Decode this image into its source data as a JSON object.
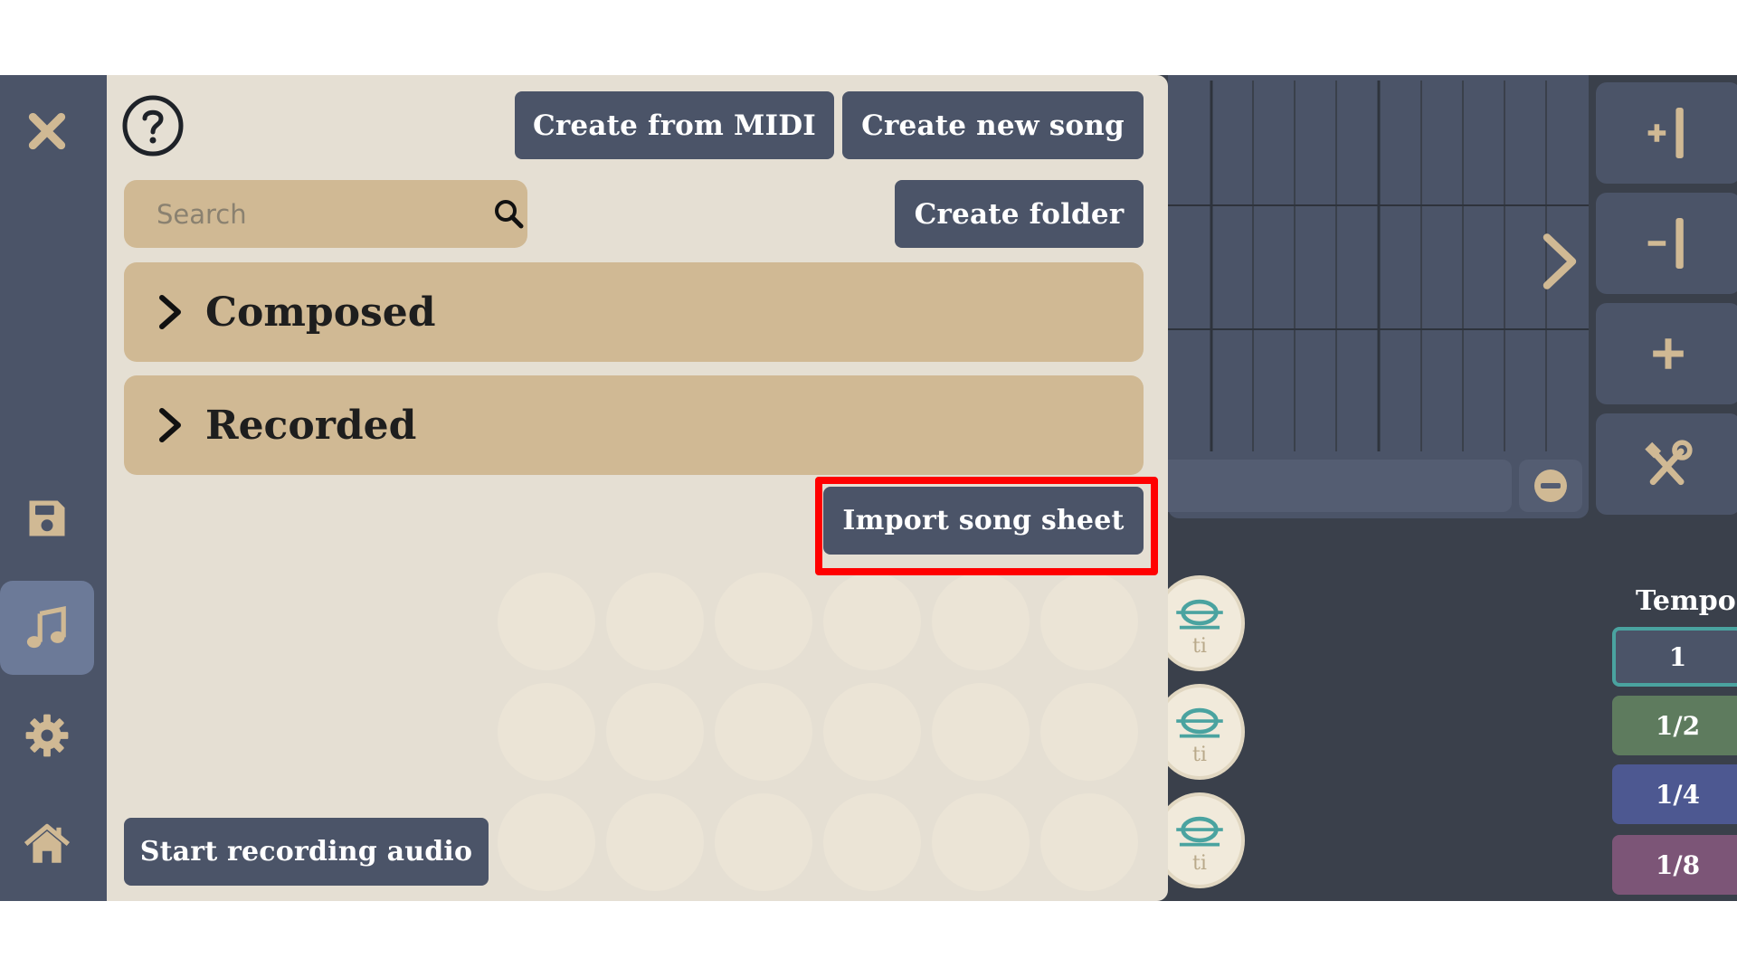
{
  "left_nav": {
    "items": [
      {
        "icon": "close-icon",
        "color": "#d0b994"
      },
      {
        "icon": "save-icon",
        "color": "#d0b994"
      },
      {
        "icon": "music-note-icon",
        "color": "#d0b994",
        "active": true
      },
      {
        "icon": "gear-icon",
        "color": "#d0b994"
      },
      {
        "icon": "home-icon",
        "color": "#d0b994"
      }
    ]
  },
  "menu": {
    "help_icon": "question-circle-icon",
    "create_from_midi_label": "Create from MIDI",
    "create_new_song_label": "Create new song",
    "search_placeholder": "Search",
    "create_folder_label": "Create folder",
    "folders": [
      {
        "label": "Composed"
      },
      {
        "label": "Recorded"
      }
    ],
    "import_song_sheet_label": "Import song sheet",
    "start_recording_label": "Start recording audio"
  },
  "toolbar": {
    "add_column_icon": "add-column-icon",
    "remove_column_icon": "remove-column-icon",
    "add_icon": "plus-icon",
    "tools_icon": "tools-icon"
  },
  "notes": [
    {
      "label": "ti"
    },
    {
      "label": "ti"
    },
    {
      "label": "ti"
    }
  ],
  "tempo": {
    "label": "Tempo",
    "options": [
      {
        "label": "1",
        "color": "#4b5468",
        "selected": true
      },
      {
        "label": "1/2",
        "color": "#5e7b5e"
      },
      {
        "label": "1/4",
        "color": "#4d5891"
      },
      {
        "label": "1/8",
        "color": "#7c5577"
      }
    ]
  },
  "colors": {
    "accent": "#d0b994",
    "panel": "#e5dfd3",
    "dark_button": "#4b5468",
    "highlight": "#ff0000",
    "selected_outline": "#4aa3a0"
  }
}
